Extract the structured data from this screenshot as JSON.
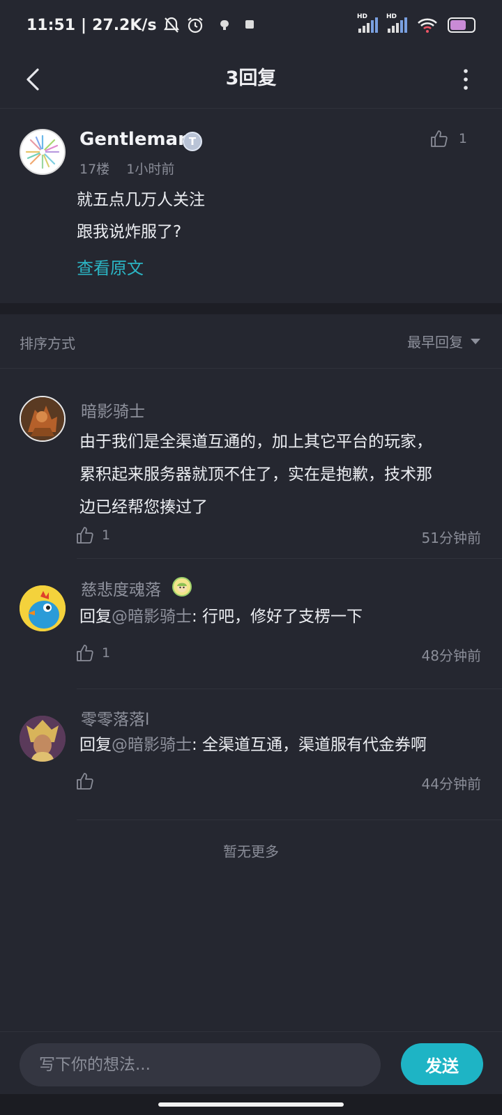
{
  "status_bar": {
    "time": "11:51",
    "separator": "|",
    "net_speed": "27.2K/s",
    "signal_label": "HD",
    "icons": [
      "bell-off-icon",
      "alarm-icon",
      "app-icon",
      "app-icon",
      "signal-icon",
      "signal-icon",
      "wifi-icon",
      "battery-icon"
    ],
    "battery_level": 0.7
  },
  "header": {
    "title": "3回复",
    "icons": [
      "back-arrow-icon",
      "more-vertical-icon"
    ]
  },
  "main_comment": {
    "author": "Gentleman",
    "badge": "T",
    "floor": "17楼",
    "time": "1小时前",
    "likes": "1",
    "lines": [
      "就五点几万人关注",
      "跟我说炸服了?"
    ],
    "view_original": "查看原文"
  },
  "sort": {
    "label": "排序方式",
    "selected": "最早回复"
  },
  "replies": [
    {
      "author": "暗影骑士",
      "text_lines": [
        "由于我们是全渠道互通的，加上其它平台的玩家，",
        "累积起来服务器就顶不住了，实在是抱歉，技术那",
        "边已经帮您揍过了"
      ],
      "likes": "1",
      "time": "51分钟前"
    },
    {
      "author": "慈悲度魂落",
      "prefix": "回复",
      "mention": "@暗影骑士",
      "text": ": 行吧，修好了支楞一下",
      "likes": "1",
      "time": "48分钟前"
    },
    {
      "author": "零零落落l",
      "prefix": "回复",
      "mention": "@暗影骑士",
      "text": ": 全渠道互通，渠道服有代金券啊",
      "likes": "",
      "time": "44分钟前"
    }
  ],
  "no_more": "暂无更多",
  "composer": {
    "placeholder": "写下你的想法...",
    "value": "",
    "send_label": "发送"
  },
  "colors": {
    "background": "#252730",
    "accent": "#1eb4c5",
    "link": "#2bb5c4",
    "muted_text": "#8a8d98"
  }
}
